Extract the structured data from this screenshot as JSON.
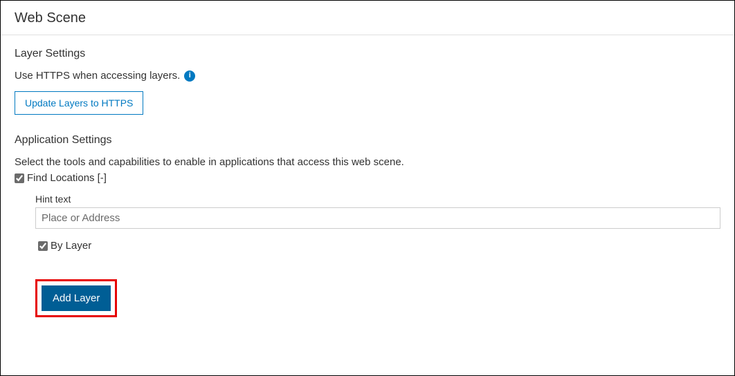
{
  "header": {
    "title": "Web Scene"
  },
  "layerSettings": {
    "title": "Layer Settings",
    "description": "Use HTTPS when accessing layers.",
    "info_icon": "i",
    "update_button": "Update Layers to HTTPS"
  },
  "appSettings": {
    "title": "Application Settings",
    "description": "Select the tools and capabilities to enable in applications that access this web scene.",
    "findLocations": {
      "label": "Find Locations",
      "collapse": "[-]",
      "checked": true
    },
    "hint": {
      "label": "Hint text",
      "value": "Place or Address"
    },
    "byLayer": {
      "label": "By Layer",
      "checked": true
    },
    "addLayer_button": "Add Layer"
  }
}
